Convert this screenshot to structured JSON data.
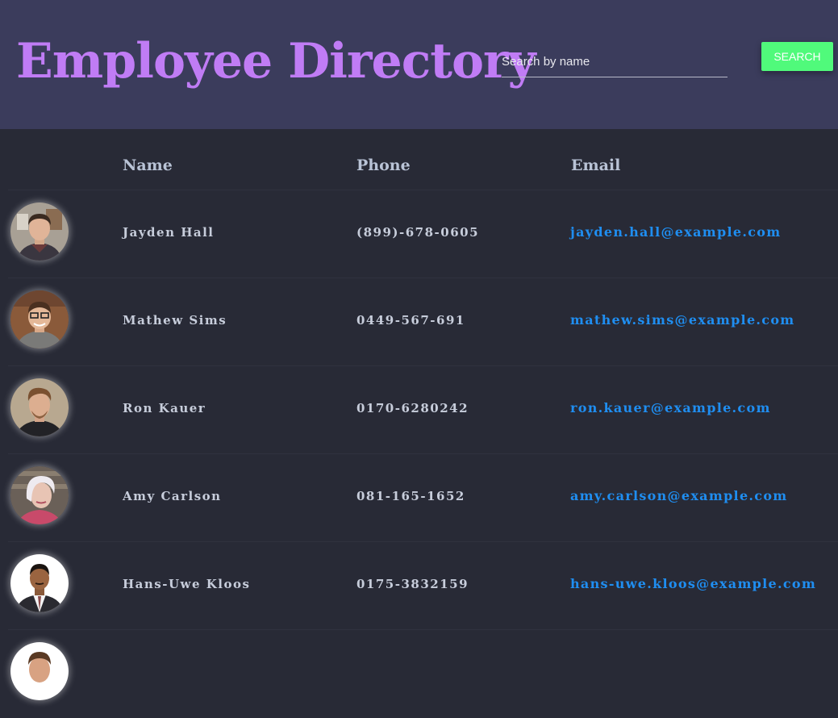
{
  "header": {
    "title": "Employee Directory",
    "search_placeholder": "Search by name",
    "search_value": "",
    "search_button_label": "SEARCH"
  },
  "table": {
    "columns": [
      "Name",
      "Phone",
      "Email"
    ],
    "rows": [
      {
        "name": "Jayden Hall",
        "phone": "(899)-678-0605",
        "email": "jayden.hall@example.com",
        "avatar_icon": "person-photo-icon"
      },
      {
        "name": "Mathew Sims",
        "phone": "0449-567-691",
        "email": "mathew.sims@example.com",
        "avatar_icon": "person-photo-icon"
      },
      {
        "name": "Ron Kauer",
        "phone": "0170-6280242",
        "email": "ron.kauer@example.com",
        "avatar_icon": "person-photo-icon"
      },
      {
        "name": "Amy Carlson",
        "phone": "081-165-1652",
        "email": "amy.carlson@example.com",
        "avatar_icon": "person-photo-icon"
      },
      {
        "name": "Hans-Uwe Kloos",
        "phone": "0175-3832159",
        "email": "hans-uwe.kloos@example.com",
        "avatar_icon": "person-photo-icon"
      }
    ]
  },
  "colors": {
    "header_bg": "#3b3c5c",
    "page_bg": "#282a36",
    "title": "#c07cf5",
    "button": "#50fa7b",
    "email_link": "#1f8ef1"
  }
}
